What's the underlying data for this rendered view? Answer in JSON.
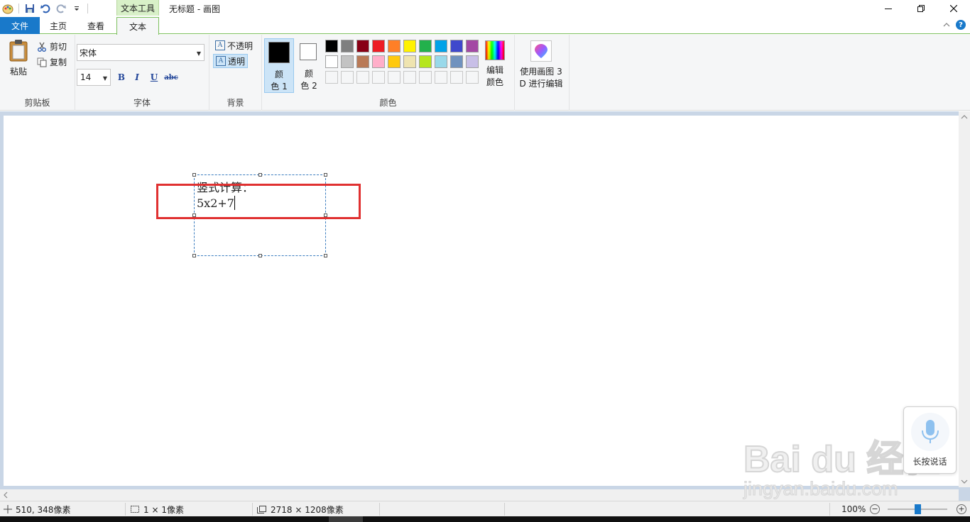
{
  "window": {
    "context_tab_label": "文本工具",
    "title": "无标题 - 画图"
  },
  "tabs": {
    "file": "文件",
    "home": "主页",
    "view": "查看",
    "text": "文本"
  },
  "ribbon": {
    "clipboard": {
      "label": "剪贴板",
      "paste": "粘贴",
      "cut": "剪切",
      "copy": "复制"
    },
    "font": {
      "label": "字体",
      "family": "宋体",
      "size": "14",
      "bold": "B",
      "italic": "I",
      "underline": "U",
      "strikethrough": "abc"
    },
    "background": {
      "label": "背景",
      "opaque": "不透明",
      "transparent": "透明",
      "selected": "transparent"
    },
    "colors": {
      "label": "颜色",
      "color1_label": "颜色 1",
      "color1_line1": "颜",
      "color1_line2": "色 1",
      "color2_line1": "颜",
      "color2_line2": "色 2",
      "color1_value": "#000000",
      "color2_value": "#ffffff",
      "palette_row1": [
        "#000000",
        "#7f7f7f",
        "#880015",
        "#ed1c24",
        "#ff7f27",
        "#fff200",
        "#22b14c",
        "#00a2e8",
        "#3f48cc",
        "#a349a4"
      ],
      "palette_row2": [
        "#ffffff",
        "#c3c3c3",
        "#b97a57",
        "#ffaec9",
        "#ffc90e",
        "#efe4b0",
        "#b5e61d",
        "#99d9ea",
        "#7092be",
        "#c8bfe7"
      ],
      "edit_colors_line1": "编辑",
      "edit_colors_line2": "颜色"
    },
    "paint3d": {
      "line1": "使用画图 3",
      "line2": "D 进行编辑"
    }
  },
  "canvas": {
    "text_line1": "竖式计算：",
    "text_line2": "5x2+7"
  },
  "voice": {
    "label": "长按说话"
  },
  "watermark": {
    "brand": "Bai du 经验",
    "url": "jingyan.baidu.com"
  },
  "status": {
    "cursor_position": "510, 348像素",
    "selection_size": "1 × 1像素",
    "canvas_size": "2718 × 1208像素",
    "zoom": "100%",
    "zoom_minus": "−",
    "zoom_plus": "+"
  }
}
